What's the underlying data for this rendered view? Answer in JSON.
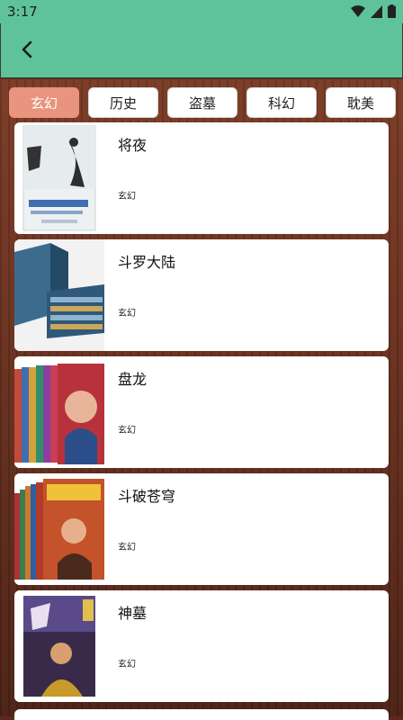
{
  "status": {
    "time": "3:17"
  },
  "tabs": [
    {
      "label": "玄幻",
      "active": true
    },
    {
      "label": "历史",
      "active": false
    },
    {
      "label": "盗墓",
      "active": false
    },
    {
      "label": "科幻",
      "active": false
    },
    {
      "label": "耽美",
      "active": false
    }
  ],
  "books": [
    {
      "title": "将夜",
      "category": "玄幻"
    },
    {
      "title": "斗罗大陆",
      "category": "玄幻"
    },
    {
      "title": "盘龙",
      "category": "玄幻"
    },
    {
      "title": "斗破苍穹",
      "category": "玄幻"
    },
    {
      "title": "神墓",
      "category": "玄幻"
    }
  ],
  "colors": {
    "appbar": "#5fc39a",
    "active_tab": "#e8947e",
    "background": "#6a311f"
  }
}
